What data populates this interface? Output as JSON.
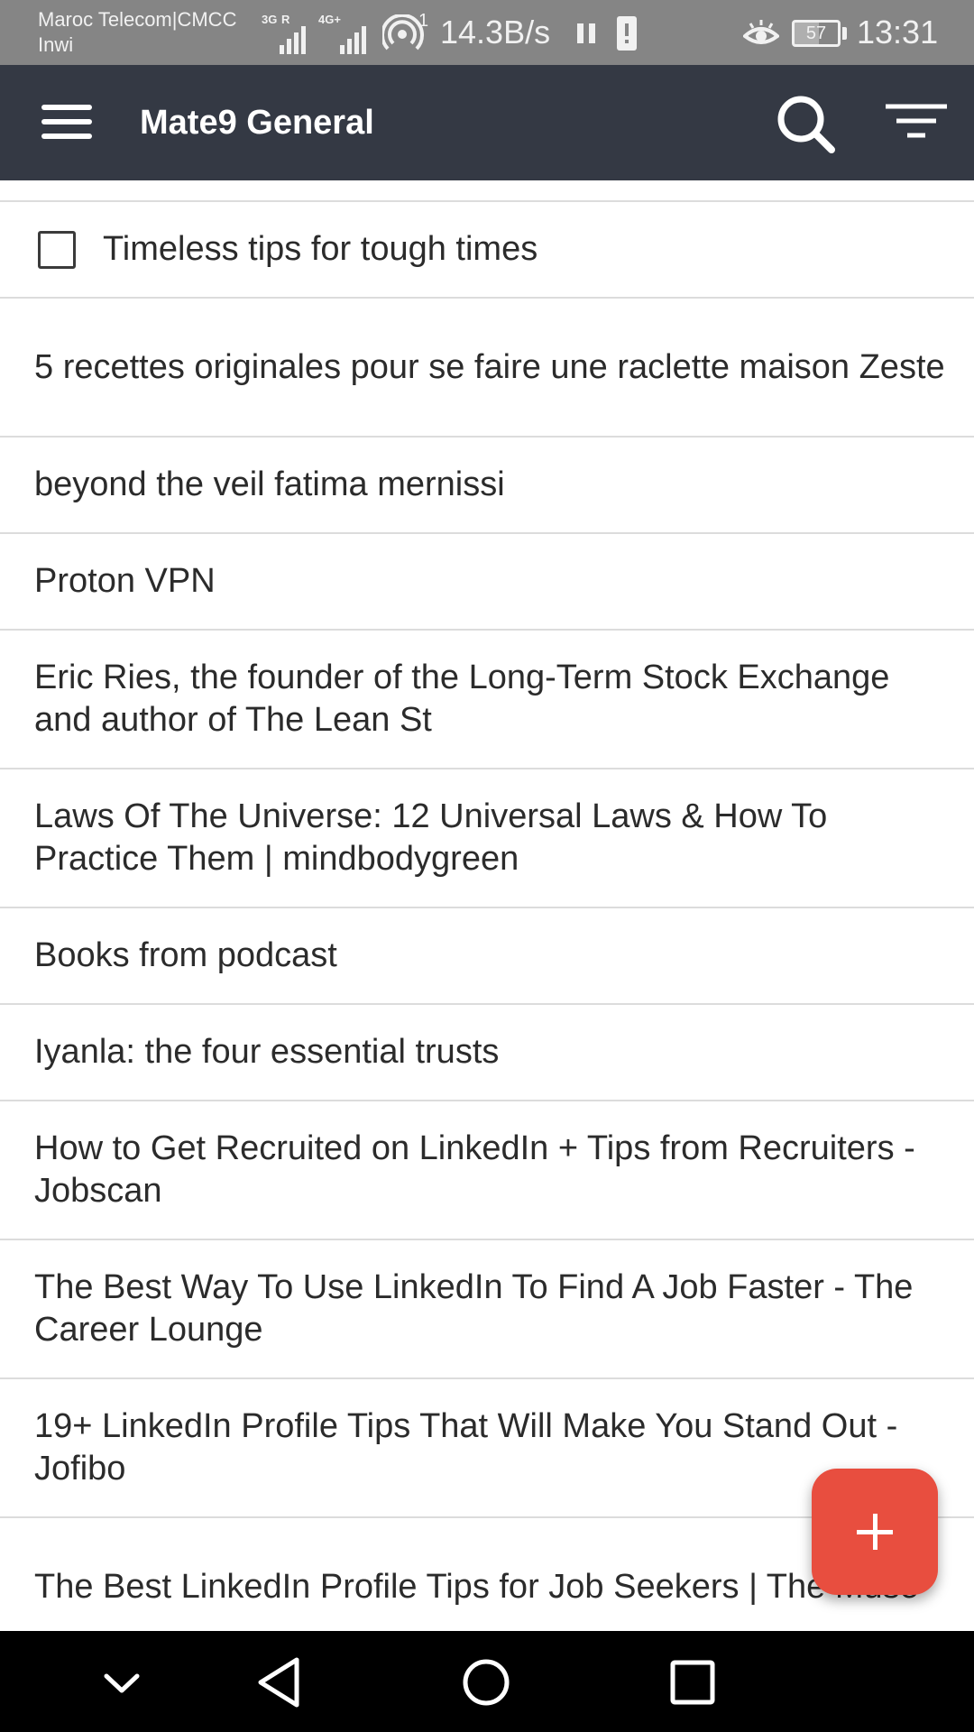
{
  "status_bar": {
    "carrier_line1": "Maroc Telecom|CMCC",
    "carrier_line2": "Inwi",
    "sim1_label": "3G",
    "sim1_sublabel": "R",
    "sim2_label": "4G+",
    "hotspot_count": "1",
    "net_speed": "14.3B/s",
    "battery_level": "57",
    "time": "13:31",
    "icons": [
      "signal-icon",
      "hotspot-icon",
      "pause-icon",
      "battery-alert-icon",
      "eye-icon",
      "battery-icon"
    ]
  },
  "app_bar": {
    "title": "Mate9 General",
    "icons": [
      "menu-icon",
      "search-icon",
      "filter-icon"
    ]
  },
  "list": {
    "items": [
      {
        "text": "Timeless tips for tough times",
        "checkbox": true
      },
      {
        "text": "5 recettes originales pour se faire une raclette maison Zeste"
      },
      {
        "text": "beyond the veil fatima mernissi"
      },
      {
        "text": "Proton VPN"
      },
      {
        "text": "Eric Ries, the founder of the Long-Term Stock Exchange and author of The Lean St"
      },
      {
        "text": "Laws Of The Universe: 12 Universal Laws & How To Practice Them | mindbodygreen"
      },
      {
        "text": "Books from podcast"
      },
      {
        "text": "Iyanla: the four essential trusts"
      },
      {
        "text": "How to Get Recruited on LinkedIn + Tips from Recruiters - Jobscan"
      },
      {
        "text": "The Best Way To Use LinkedIn To Find A Job Faster - The Career Lounge"
      },
      {
        "text": "19+ LinkedIn Profile Tips That Will Make You Stand Out - Jofibo"
      },
      {
        "text": "The Best LinkedIn Profile Tips for Job Seekers | The Muse"
      }
    ]
  },
  "fab": {
    "icon": "plus-icon"
  },
  "nav_bar": {
    "icons": [
      "chevron-down-icon",
      "back-icon",
      "home-icon",
      "recents-icon"
    ]
  },
  "colors": {
    "status_bar": "#858585",
    "app_bar": "#343944",
    "fab": "#e84e3f",
    "divider": "#dcdcdc",
    "text": "#2b2b2b",
    "nav_bar": "#000000"
  }
}
